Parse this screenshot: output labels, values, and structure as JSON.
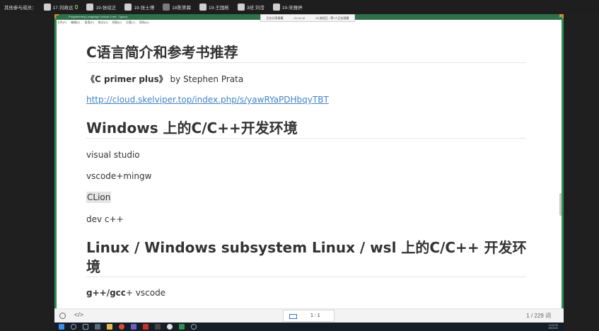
{
  "meeting": {
    "label": "其他参与成员：",
    "participants": [
      {
        "name": "17-刘政远"
      },
      {
        "name": "19-张绍正"
      },
      {
        "name": "19-张士博"
      },
      {
        "name": "18陈美霖"
      },
      {
        "name": "19-王国栋"
      },
      {
        "name": "3班 刘滢"
      },
      {
        "name": "19-宋雅婷"
      }
    ]
  },
  "share_banner": {
    "status": "正在分享屏幕",
    "timer": "00:18:48",
    "note": "19-张绍正...等7人正在观看"
  },
  "app": {
    "title": "Programming Language Lecture 0.md - Typora",
    "menus": [
      "文件(F)",
      "编辑(E)",
      "段落(P)",
      "格式(O)",
      "视图(V)",
      "主题(T)",
      "帮助(H)"
    ],
    "colors": {
      "frame_green": "#2f8f4f",
      "accent_orange": "#e08a1e",
      "link_blue": "#4183c4"
    }
  },
  "doc": {
    "h1": "C语言简介和参考书推荐",
    "book": {
      "title": "《C primer plus》",
      "author": " by Stephen Prata"
    },
    "link": "http://cloud.skelviper.top/index.php/s/yawRYaPDHbqyTBT",
    "h2": "Windows 上的C/C++开发环境",
    "tools": [
      "visual studio",
      "vscode+mingw",
      "CLion",
      "dev c++"
    ],
    "h3_line1": "Linux / Windows subsystem Linux / wsl 上的C/C++ 开发环",
    "h3_line2": "境",
    "last": {
      "bold": "g++/gcc",
      "rest": "+ vscode"
    }
  },
  "status": {
    "source_icon": "</>",
    "zoom": "1 : 1",
    "word_count": "1 / 229 词"
  },
  "taskbar": {
    "time": "3:18 PM",
    "date": "3/9/2020"
  }
}
